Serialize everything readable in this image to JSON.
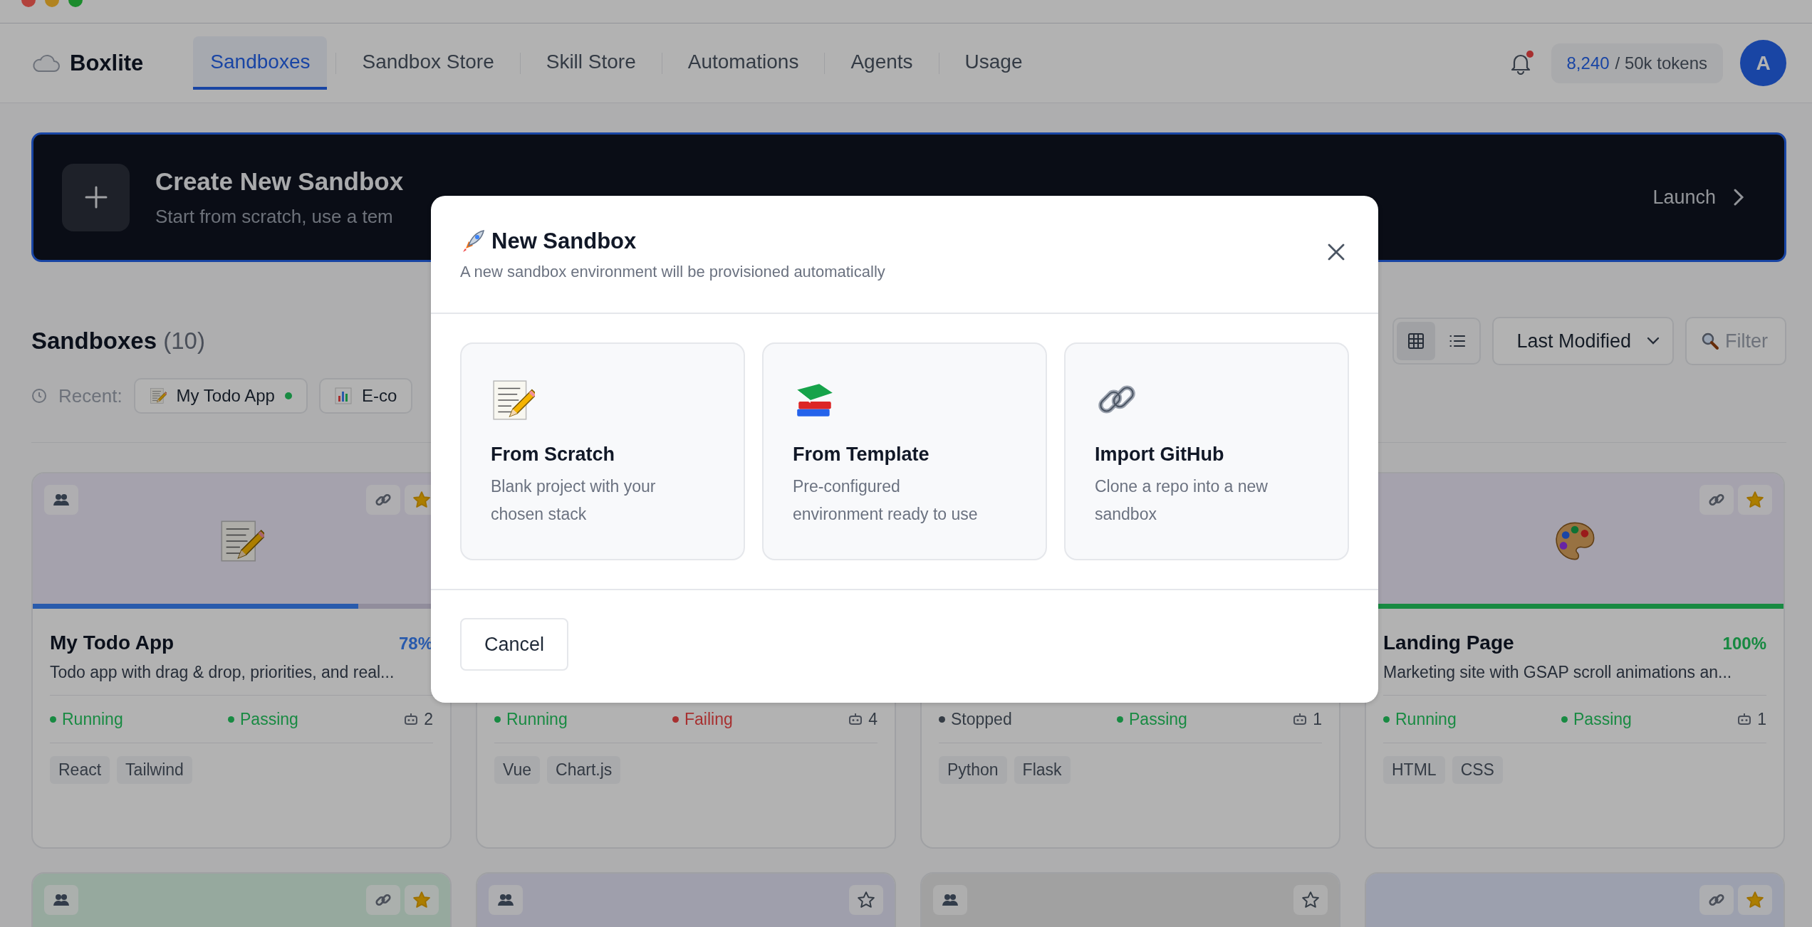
{
  "nav": {
    "logo": "Boxlite",
    "tabs": [
      {
        "label": "Sandboxes",
        "selected": true
      },
      {
        "label": "Sandbox Store",
        "selected": false
      },
      {
        "label": "Skill Store",
        "selected": false
      },
      {
        "label": "Automations",
        "selected": false
      },
      {
        "label": "Agents",
        "selected": false
      },
      {
        "label": "Usage",
        "selected": false
      }
    ],
    "notifications_unread": true,
    "tokens": {
      "used": "8,240",
      "limit": "/ 50k tokens"
    },
    "avatar": "A"
  },
  "banner": {
    "title": "Create New Sandbox",
    "subtitle": "Start from scratch, use a tem",
    "action": "Launch"
  },
  "section": {
    "title": "Sandboxes",
    "count": "(10)",
    "view_options": [
      {
        "kind": "grid",
        "selected": true
      },
      {
        "kind": "list",
        "selected": false
      }
    ],
    "sort": "Last Modified",
    "filter": "Filter",
    "recent_label": "Recent:",
    "recent": [
      {
        "kind": "notes",
        "label": "My Todo App",
        "color": "#188a42"
      },
      {
        "kind": "chart",
        "label": "E-co"
      }
    ]
  },
  "cards": [
    {
      "color": "#a5a2ad",
      "kind": "notes",
      "shared": true,
      "linked": true,
      "starred": true,
      "title": "My Todo App",
      "percent": "78%",
      "level": 0.78,
      "description": "Todo app with drag & drop, priorities, and real...",
      "status": [
        {
          "label": "Running",
          "color": "#188a42"
        },
        {
          "label": "Passing",
          "color": "#188a42"
        }
      ],
      "agents": "2",
      "tags": [
        "React",
        "Tailwind"
      ]
    },
    {
      "status": [
        {
          "label": "Running",
          "color": "#188a42"
        },
        {
          "label": "Failing",
          "color": "#a73030"
        }
      ],
      "agents": "4",
      "tags": [
        "Vue",
        "Chart.js"
      ]
    },
    {
      "status": [
        {
          "label": "Stopped",
          "color": "#353c45"
        },
        {
          "label": "Passing",
          "color": "#188a42"
        }
      ],
      "agents": "1",
      "tags": [
        "Python",
        "Flask"
      ]
    },
    {
      "color": "#a5a2ad",
      "kind": "palette",
      "shared": false,
      "linked": true,
      "starred": true,
      "title": "Landing Page",
      "percent": "100%",
      "level": 1,
      "description": "Marketing site with GSAP scroll animations an...",
      "status": [
        {
          "label": "Running",
          "color": "#188a42"
        },
        {
          "label": "Passing",
          "color": "#188a42"
        }
      ],
      "agents": "1",
      "tags": [
        "HTML",
        "CSS"
      ]
    },
    {
      "color": "#96a99e",
      "shared": true,
      "linked": true,
      "starred": true
    },
    {
      "color": "#9f9fac",
      "shared": true,
      "linked": false,
      "starred": false
    },
    {
      "color": "#a1a1a1",
      "shared": true,
      "linked": false,
      "starred": false
    },
    {
      "color": "#9ca0ae",
      "shared": false,
      "linked": true,
      "starred": true
    }
  ],
  "modal": {
    "title": "New Sandbox",
    "subtitle": "A new sandbox environment will be provisioned automatically",
    "options": [
      {
        "kind": "scratch",
        "title": "From Scratch",
        "description": "Blank project with your chosen stack"
      },
      {
        "kind": "template",
        "title": "From Template",
        "description": "Pre-configured environment ready to use"
      },
      {
        "kind": "github",
        "title": "Import GitHub",
        "description": "Clone a repo into a new sandbox"
      }
    ],
    "cancel": "Cancel"
  }
}
